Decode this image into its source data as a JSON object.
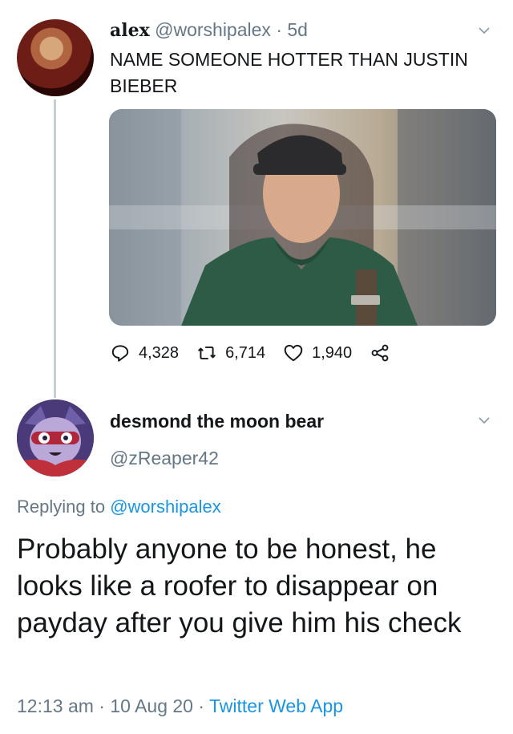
{
  "tweet1": {
    "name": "alex",
    "handle": "@worshipalex",
    "time": "5d",
    "separator": "·",
    "text": "NAME SOMEONE HOTTER THAN JUSTIN BIEBER",
    "replies": "4,328",
    "retweets": "6,714",
    "likes": "1,940"
  },
  "tweet2": {
    "name": "desmond the moon bear",
    "handle": "@zReaper42",
    "replying_prefix": "Replying to",
    "replying_to": "@worshipalex",
    "text": "Probably anyone to be honest, he looks like a roofer to disappear on payday after you give him his check",
    "time": "12:13 am",
    "date": "10 Aug 20",
    "source": "Twitter Web App",
    "separator": "·"
  },
  "icons": {
    "reply": "reply-icon",
    "retweet": "retweet-icon",
    "like": "like-icon",
    "share": "share-icon",
    "chevron": "chevron-down-icon"
  },
  "colors": {
    "text": "#14171a",
    "muted": "#657786",
    "link": "#1b95e0",
    "thread_line": "#c4ced6"
  }
}
